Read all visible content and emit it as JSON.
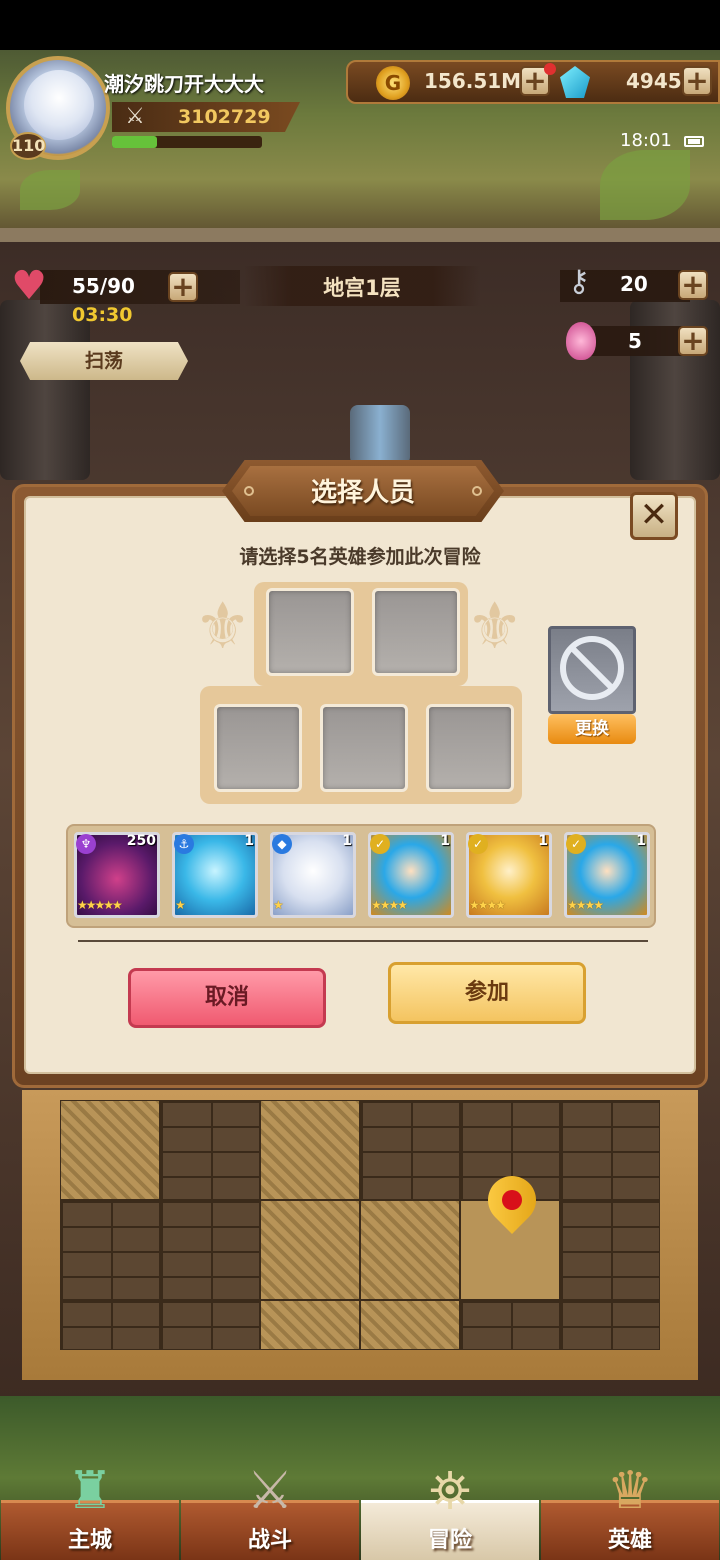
{
  "player": {
    "name": "潮汐跳刀开大大大",
    "level": "110",
    "power": "3102729",
    "xp_fraction": 0.3
  },
  "currency": {
    "gold": "156.51M",
    "gems": "4945",
    "plus_label": "+"
  },
  "status": {
    "time": "18:01"
  },
  "dungeon": {
    "stamina": "55/90",
    "stamina_timer": "03:30",
    "sweep_label": "扫荡",
    "floor_title": "地宫1层",
    "keys": "20",
    "eggs": "5"
  },
  "modal": {
    "title": "选择人员",
    "close_label": "✕",
    "instruction": "请选择5名英雄参加此次冒险",
    "swap_label": "更换",
    "cancel_label": "取消",
    "join_label": "参加"
  },
  "heroes": [
    {
      "level": "250",
      "stars": "★★★★★",
      "badge": "♆",
      "badge_color": "#9a40d0"
    },
    {
      "level": "1",
      "stars": "★",
      "badge": "⚓",
      "badge_color": "#2a7ae0"
    },
    {
      "level": "1",
      "stars": "★",
      "badge": "◆",
      "badge_color": "#2a7ae0"
    },
    {
      "level": "1",
      "stars": "★★★★",
      "badge": "✓",
      "badge_color": "#e0b020"
    },
    {
      "level": "1",
      "stars": "★★★★",
      "badge": "✓",
      "badge_color": "#e0b020"
    },
    {
      "level": "1",
      "stars": "★★★★",
      "badge": "✓",
      "badge_color": "#e0b020"
    }
  ],
  "nav": {
    "items": [
      {
        "label": "主城",
        "icon": "castle-icon"
      },
      {
        "label": "战斗",
        "icon": "crossed-swords-icon"
      },
      {
        "label": "冒险",
        "icon": "adventure-map-icon"
      },
      {
        "label": "英雄",
        "icon": "hero-crest-icon"
      }
    ],
    "active_index": 2
  },
  "colors": {
    "accent_gold": "#f2c860",
    "cancel_pink": "#f05a70",
    "join_yellow": "#f4c460"
  }
}
